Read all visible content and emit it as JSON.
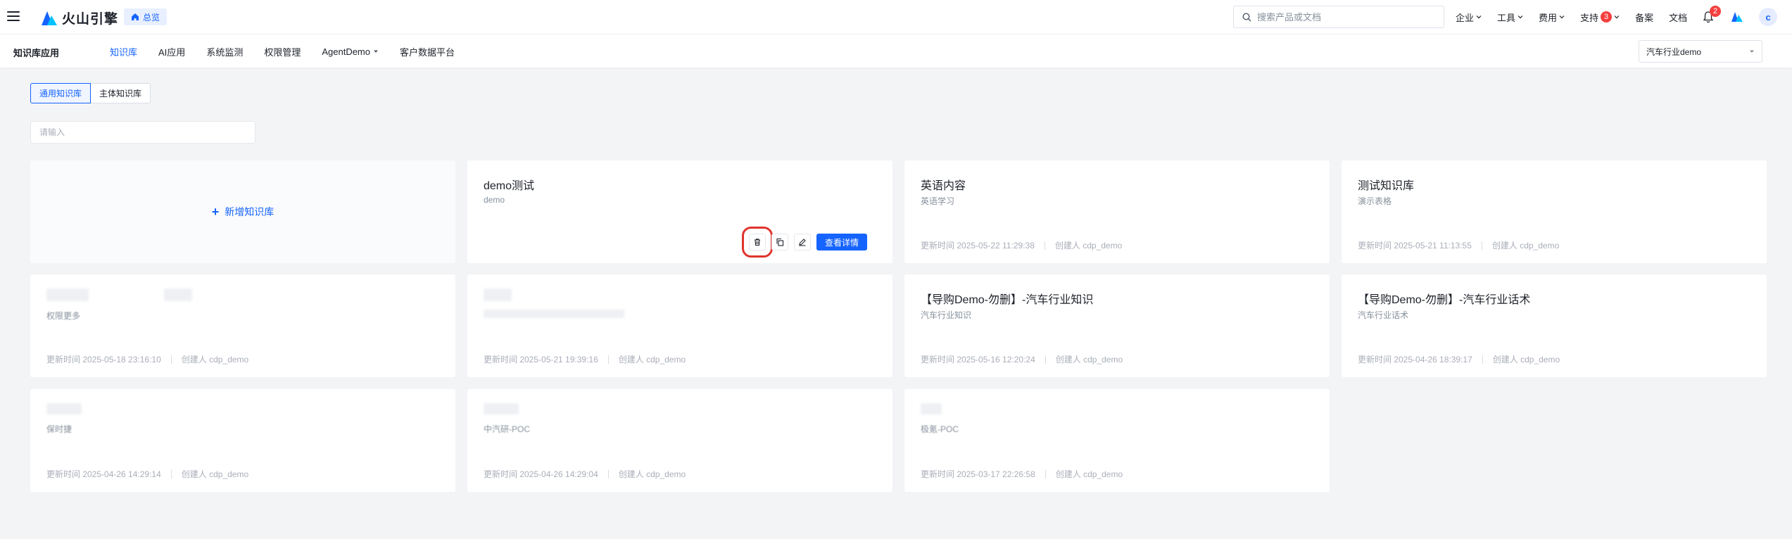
{
  "header": {
    "brand": "火山引擎",
    "home_chip": "总览",
    "search_placeholder": "搜索产品或文档",
    "nav": [
      {
        "label": "企业",
        "dropdown": true
      },
      {
        "label": "工具",
        "dropdown": true
      },
      {
        "label": "费用",
        "dropdown": true
      },
      {
        "label": "支持",
        "dropdown": true,
        "badge": "3"
      },
      {
        "label": "备案"
      },
      {
        "label": "文档"
      }
    ],
    "bell_badge": "2",
    "avatar_initial": "c"
  },
  "subnav": {
    "app_title": "知识库应用",
    "tabs": [
      {
        "label": "知识库",
        "active": true
      },
      {
        "label": "AI应用"
      },
      {
        "label": "系统监测"
      },
      {
        "label": "权限管理"
      },
      {
        "label": "AgentDemo",
        "dropdown": true
      },
      {
        "label": "客户数据平台"
      }
    ],
    "industry_select": "汽车行业demo"
  },
  "kb_tabs": [
    "通用知识库",
    "主体知识库"
  ],
  "filter_placeholder": "请输入",
  "new_card_label": "新增知识库",
  "card_actions": {
    "detail_label": "查看详情"
  },
  "colors": {
    "accent": "#1664ff",
    "highlight": "#e0342c",
    "badge": "#f53f3f"
  },
  "cards": [
    {
      "name": "demo测试",
      "desc": "demo",
      "updated": "",
      "creator": "",
      "hover": true
    },
    {
      "name": "英语内容",
      "desc": "英语学习",
      "updated": "更新时间 2025-05-22 11:29:38",
      "creator": "创建人 cdp_demo"
    },
    {
      "name": "测试知识库",
      "desc": "演示表格",
      "updated": "更新时间 2025-05-21 11:13:55",
      "creator": "创建人 cdp_demo"
    },
    {
      "name": "",
      "desc": "权限更多",
      "updated": "更新时间 2025-05-18 23:16:10",
      "creator": "创建人 cdp_demo",
      "blurred": true
    },
    {
      "name": "",
      "desc": "",
      "updated": "更新时间 2025-05-21 19:39:16",
      "creator": "创建人 cdp_demo",
      "blurred": true
    },
    {
      "name": "【导购Demo-勿删】-汽车行业知识",
      "desc": "汽车行业知识",
      "updated": "更新时间 2025-05-16 12:20:24",
      "creator": "创建人 cdp_demo"
    },
    {
      "name": "【导购Demo-勿删】-汽车行业话术",
      "desc": "汽车行业话术",
      "updated": "更新时间 2025-04-26 18:39:17",
      "creator": "创建人 cdp_demo"
    },
    {
      "name": "",
      "desc": "保时捷",
      "updated": "更新时间 2025-04-26 14:29:14",
      "creator": "创建人 cdp_demo",
      "blurred": true
    },
    {
      "name": "",
      "desc": "中汽研-POC",
      "updated": "更新时间 2025-04-26 14:29:04",
      "creator": "创建人 cdp_demo",
      "blurred": true
    },
    {
      "name": "",
      "desc": "极氪-POC",
      "updated": "更新时间 2025-03-17 22:26:58",
      "creator": "创建人 cdp_demo",
      "blurred": true
    }
  ]
}
